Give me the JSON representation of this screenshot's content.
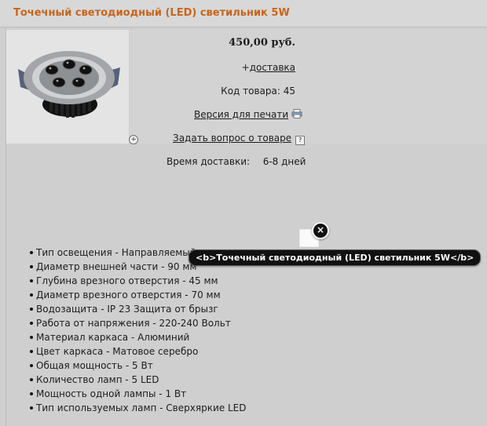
{
  "product": {
    "title": "Точечный светодиодный (LED) светильник 5W",
    "price": "450,00 руб.",
    "delivery_prefix": "+",
    "delivery_link": "доставка",
    "code": "Код товара: 45",
    "print_version": "Версия для печати",
    "ask_question": "Задать вопрос о товаре",
    "delivery_time_label": "Время доставки:",
    "delivery_time_value": "6-8 дней"
  },
  "tooltip": {
    "text": "<b>Точечный светодиодный (LED) светильник 5W</b>"
  },
  "specs": [
    "Тип освещения  - Направляемый",
    "Диаметр внешней части - 90 мм",
    "Глубина врезного отверстия - 45 мм",
    "Диаметр врезного отверстия - 70 мм",
    "Водозащита - IP 23 Защита от брызг",
    "Работа от напряжения - 220-240 Вольт",
    "Материал каркаса - Алюминий",
    "Цвет каркаса - Матовое серебро",
    "Общая мощность - 5 Вт",
    "Количество ламп - 5 LED",
    "Мощность одной лампы - 1 Вт",
    "Тип используемых ламп - Сверхяркие LED"
  ],
  "icons": {
    "zoom": "zoom-plus-icon",
    "printer": "printer-icon",
    "question": "question-icon",
    "close": "close-icon"
  },
  "colors": {
    "title": "#c8651b",
    "tooltip_background": "#111111"
  }
}
